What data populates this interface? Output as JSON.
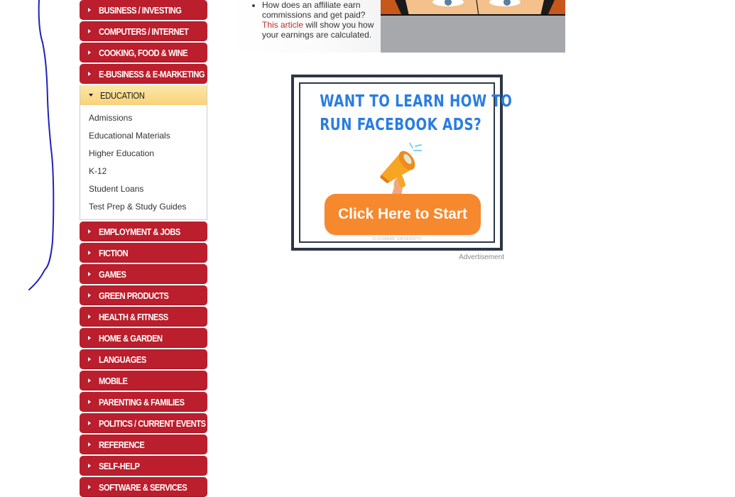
{
  "sidebar": {
    "categories": [
      {
        "label": "BUSINESS / INVESTING"
      },
      {
        "label": "COMPUTERS / INTERNET"
      },
      {
        "label": "COOKING, FOOD & WINE"
      },
      {
        "label": "E-BUSINESS & E-MARKETING"
      },
      {
        "label": "EDUCATION",
        "expanded": true
      },
      {
        "label": "EMPLOYMENT & JOBS"
      },
      {
        "label": "FICTION"
      },
      {
        "label": "GAMES"
      },
      {
        "label": "GREEN PRODUCTS"
      },
      {
        "label": "HEALTH & FITNESS"
      },
      {
        "label": "HOME & GARDEN"
      },
      {
        "label": "LANGUAGES"
      },
      {
        "label": "MOBILE"
      },
      {
        "label": "PARENTING & FAMILIES"
      },
      {
        "label": "POLITICS / CURRENT EVENTS"
      },
      {
        "label": "REFERENCE"
      },
      {
        "label": "SELF-HELP"
      },
      {
        "label": "SOFTWARE & SERVICES"
      }
    ],
    "education_subcategories": [
      "Admissions",
      "Educational Materials",
      "Higher Education",
      "K-12",
      "Student Loans",
      "Test Prep & Study Guides"
    ],
    "colors": {
      "category_bg": "#bb1e2c",
      "expanded_bg": "#fad27a"
    }
  },
  "article": {
    "bullet_text_before": "How does an affiliate earn commissions and get paid?",
    "link_text": "This article",
    "bullet_text_after": "will show you how your earnings are calculated."
  },
  "ad": {
    "title_line1": "WANT TO LEARN HOW TO",
    "title_line2": "RUN FACEBOOK ADS?",
    "button_label": "Click Here to Start",
    "brand": "CLICKBANK UNIVERSITY",
    "label": "Advertisement",
    "icon": "megaphone-icon",
    "colors": {
      "title": "#2a7de1",
      "button": "#f6882e",
      "border": "#2d3744"
    }
  }
}
